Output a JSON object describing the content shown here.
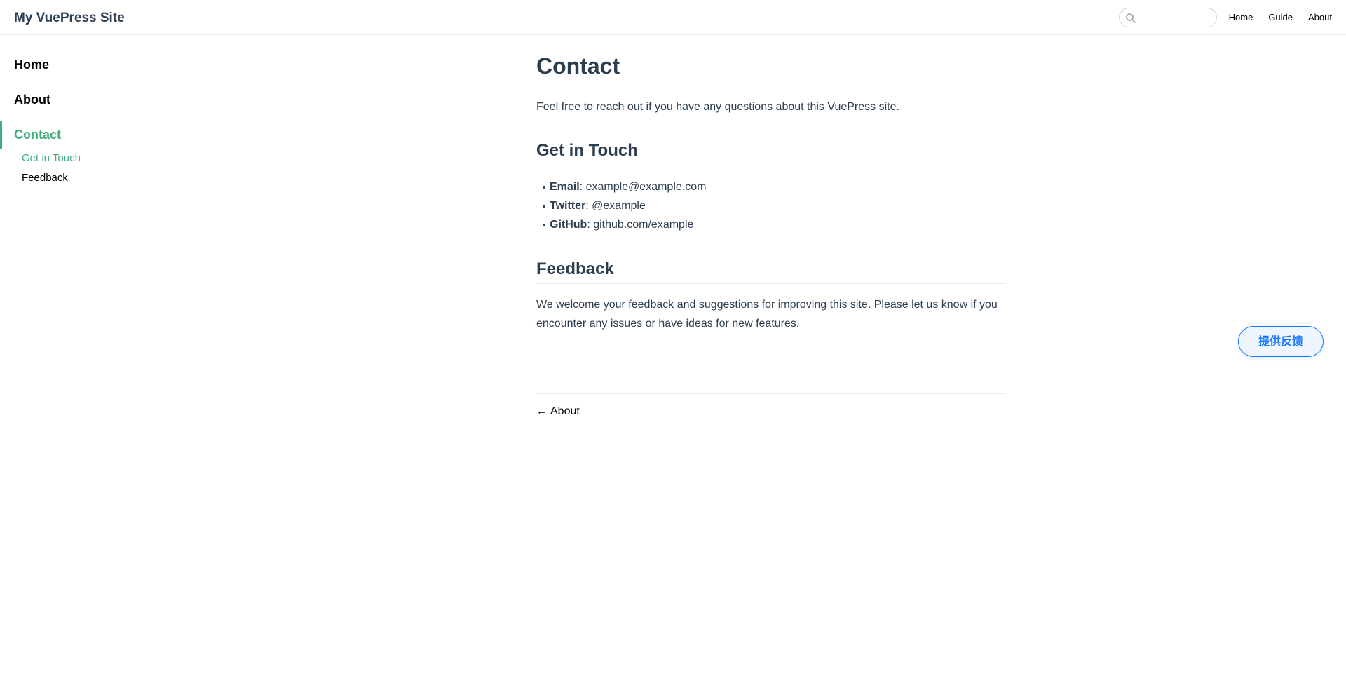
{
  "navbar": {
    "site_name": "My VuePress Site",
    "search": {
      "placeholder": "",
      "value": "",
      "icon": "search-icon"
    },
    "links": [
      "Home",
      "Guide",
      "About"
    ]
  },
  "sidebar": {
    "items": [
      {
        "label": "Home",
        "active": false
      },
      {
        "label": "About",
        "active": false
      },
      {
        "label": "Contact",
        "active": true,
        "children": [
          {
            "label": "Get in Touch",
            "active": true
          },
          {
            "label": "Feedback",
            "active": false
          }
        ]
      }
    ]
  },
  "main": {
    "title": "Contact",
    "intro": "Feel free to reach out if you have any questions about this VuePress site.",
    "sections": [
      {
        "heading": "Get in Touch",
        "items": [
          {
            "label": "Email",
            "value": ": example@example.com"
          },
          {
            "label": "Twitter",
            "value": ": @example"
          },
          {
            "label": "GitHub",
            "value": ": github.com/example"
          }
        ]
      },
      {
        "heading": "Feedback",
        "text": "We welcome your feedback and suggestions for improving this site. Please let us know if you encounter any issues or have ideas for new features."
      }
    ],
    "prev_page": {
      "arrow": "←",
      "label": "About"
    }
  },
  "feedback_widget": {
    "label": "提供反馈"
  },
  "colors": {
    "accent": "#3eaf7c",
    "text": "#2c3e50",
    "border": "#eaecef",
    "feedback_blue": "#1677ff"
  }
}
